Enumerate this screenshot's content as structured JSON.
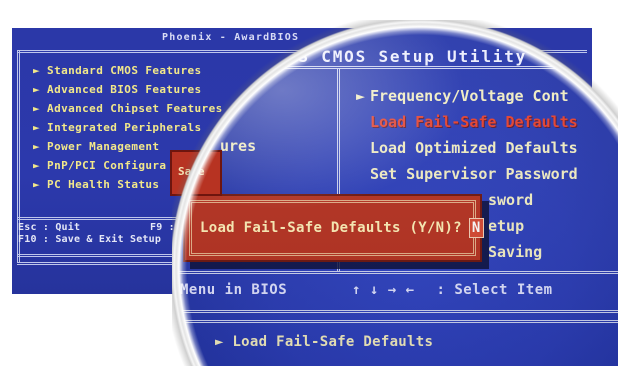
{
  "bios": {
    "title": "Phoenix - AwardBIOS",
    "left_menu": [
      "► Standard CMOS Features",
      "► Advanced BIOS Features",
      "► Advanced Chipset Features",
      "► Integrated Peripherals",
      "► Power Management",
      "► PnP/PCI Configura",
      "► PC Health Status"
    ],
    "help": {
      "quit": "Esc : Quit",
      "f9": "F9 :",
      "save_exit": "F10 : Save & Exit Setup"
    },
    "popup_label": "Save"
  },
  "magnifier": {
    "title": "OS CMOS Setup Utility",
    "left_fragment": "ures",
    "right_menu": [
      {
        "marker": "►",
        "label": "Frequency/Voltage Cont",
        "selected": false
      },
      {
        "marker": "",
        "label": "Load Fail-Safe Defaults",
        "selected": true
      },
      {
        "marker": "",
        "label": "Load Optimized Defaults",
        "selected": false
      },
      {
        "marker": "",
        "label": "Set Supervisor Password",
        "selected": false
      }
    ],
    "partial_items": [
      "sword",
      "etup",
      "Saving"
    ],
    "dialog": {
      "prompt": "Load Fail-Safe Defaults (Y/N)?",
      "answer": "N"
    },
    "help": {
      "menu": "Menu in BIOS",
      "keys": "↑ ↓ → ←",
      "select": ": Select Item"
    },
    "item_help": "► Load Fail-Safe Defaults"
  },
  "colors": {
    "screen_blue": "#2b38a8",
    "menu_text": "#f2e88a",
    "highlight_text": "#e8422f",
    "dialog_red": "#b73322"
  }
}
